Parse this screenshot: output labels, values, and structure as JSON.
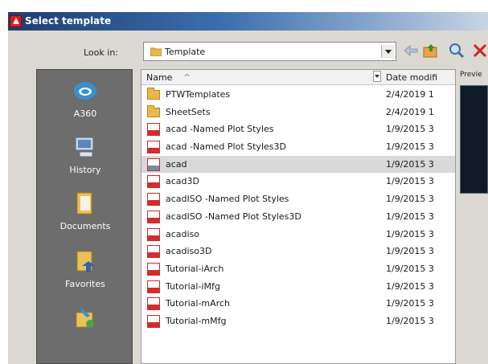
{
  "window": {
    "title": "Select template"
  },
  "toolbar": {
    "lookin_label": "Look in:",
    "lookin_value": "Template"
  },
  "places": [
    {
      "label": "A360",
      "icon": "a360-icon"
    },
    {
      "label": "History",
      "icon": "history-icon"
    },
    {
      "label": "Documents",
      "icon": "documents-icon"
    },
    {
      "label": "Favorites",
      "icon": "favorites-icon"
    },
    {
      "label": "",
      "icon": "ftp-icon"
    }
  ],
  "list": {
    "columns": {
      "name": "Name",
      "date": "Date modifi"
    },
    "rows": [
      {
        "name": "PTWTemplates",
        "date": "2/4/2019 1",
        "type": "folder"
      },
      {
        "name": "SheetSets",
        "date": "2/4/2019 1",
        "type": "folder"
      },
      {
        "name": "acad -Named Plot Styles",
        "date": "1/9/2015 3",
        "type": "dwt"
      },
      {
        "name": "acad -Named Plot Styles3D",
        "date": "1/9/2015 3",
        "type": "dwt"
      },
      {
        "name": "acad",
        "date": "1/9/2015 3",
        "type": "dwt",
        "selected": true
      },
      {
        "name": "acad3D",
        "date": "1/9/2015 3",
        "type": "dwt"
      },
      {
        "name": "acadISO -Named Plot Styles",
        "date": "1/9/2015 3",
        "type": "dwt"
      },
      {
        "name": "acadISO -Named Plot Styles3D",
        "date": "1/9/2015 3",
        "type": "dwt"
      },
      {
        "name": "acadiso",
        "date": "1/9/2015 3",
        "type": "dwt"
      },
      {
        "name": "acadiso3D",
        "date": "1/9/2015 3",
        "type": "dwt"
      },
      {
        "name": "Tutorial-iArch",
        "date": "1/9/2015 3",
        "type": "dwt"
      },
      {
        "name": "Tutorial-iMfg",
        "date": "1/9/2015 3",
        "type": "dwt"
      },
      {
        "name": "Tutorial-mArch",
        "date": "1/9/2015 3",
        "type": "dwt"
      },
      {
        "name": "Tutorial-mMfg",
        "date": "1/9/2015 3",
        "type": "dwt"
      }
    ]
  },
  "preview": {
    "label": "Previe"
  }
}
